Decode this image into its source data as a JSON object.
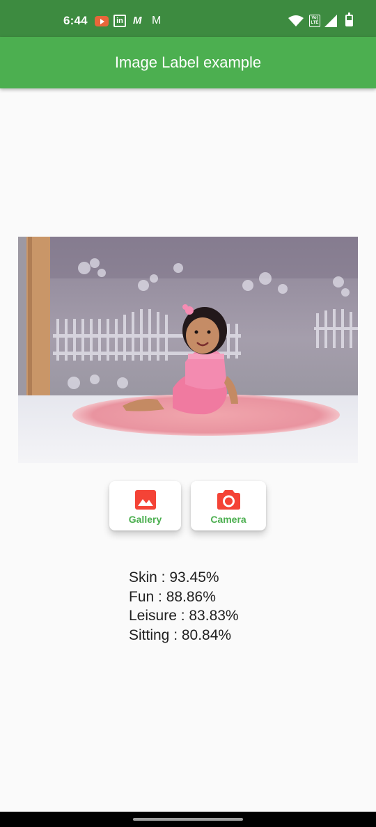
{
  "status_bar": {
    "time": "6:44",
    "notification_icons": [
      "youtube-icon",
      "linkedin-icon",
      "m-app-icon",
      "gmail-icon"
    ],
    "system_icons": [
      "wifi-icon",
      "volte-icon",
      "signal-icon",
      "battery-icon"
    ],
    "linkedin_glyph": "in",
    "m_glyph": "M",
    "gmail_glyph": "M",
    "volte_text": "Vo) LTE"
  },
  "app_bar": {
    "title": "Image Label example",
    "color": "#4caf50"
  },
  "image": {
    "description_icon": "photo"
  },
  "buttons": {
    "gallery": {
      "label": "Gallery",
      "icon": "image-icon"
    },
    "camera": {
      "label": "Camera",
      "icon": "camera-icon"
    }
  },
  "results": [
    "Skin : 93.45%",
    "Fun : 88.86%",
    "Leisure : 83.83%",
    "Sitting : 80.84%"
  ],
  "colors": {
    "status_bar": "#3d8b40",
    "accent": "#4caf50",
    "icon_red": "#f44336"
  }
}
